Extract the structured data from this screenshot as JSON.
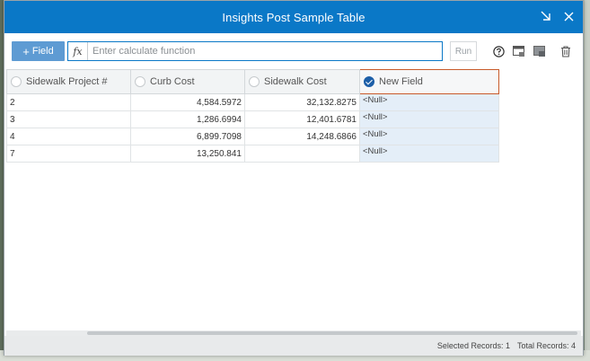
{
  "window": {
    "title": "Insights Post Sample Table"
  },
  "toolbar": {
    "add_field_label": "Field",
    "fx_label": "fx",
    "calc_placeholder": "Enter calculate function",
    "run_label": "Run"
  },
  "table": {
    "columns": [
      {
        "label": "Sidewalk Project #",
        "selected": false
      },
      {
        "label": "Curb Cost",
        "selected": false
      },
      {
        "label": "Sidewalk Cost",
        "selected": false
      },
      {
        "label": "New Field",
        "selected": true
      }
    ],
    "rows": [
      {
        "project": "2",
        "curb": "4,584.5972",
        "sidewalk": "32,132.8275",
        "new_field": "<Null>"
      },
      {
        "project": "3",
        "curb": "1,286.6994",
        "sidewalk": "12,401.6781",
        "new_field": "<Null>"
      },
      {
        "project": "4",
        "curb": "6,899.7098",
        "sidewalk": "14,248.6866",
        "new_field": "<Null>"
      },
      {
        "project": "7",
        "curb": "13,250.841",
        "sidewalk": "",
        "new_field": "<Null>"
      }
    ]
  },
  "status": {
    "selected_records": "Selected Records: 1",
    "total_records": "Total Records: 4"
  },
  "colors": {
    "titlebar": "#0a78c7",
    "selected_column_border": "#c85a2a",
    "null_cell_bg": "#e4eef8"
  }
}
